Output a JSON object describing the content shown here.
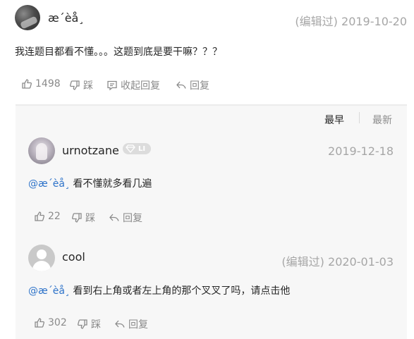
{
  "post": {
    "username": "æ´èå¸",
    "edited_label": "(编辑过)",
    "date": "2019-10-20",
    "content": "我连题目都看不懂。。。这题到底是要干嘛？？？",
    "likes": "1498",
    "dislike_label": "踩",
    "collapse_label": "收起回复",
    "reply_label": "回复"
  },
  "replies_panel": {
    "sort_earliest": "最早",
    "sort_latest": "最新",
    "replies": [
      {
        "username": "urnotzane",
        "badge": "LI",
        "date": "2019-12-18",
        "mention": "@æ´èå¸",
        "content": " 看不懂就多看几遍",
        "likes": "22",
        "dislike_label": "踩",
        "reply_label": "回复"
      },
      {
        "username": "cool",
        "edited_label": "(编辑过)",
        "date": "2020-01-03",
        "mention": "@æ´èå¸",
        "content": " 看到右上角或者左上角的那个叉叉了吗，请点击他",
        "likes": "302",
        "dislike_label": "踩",
        "reply_label": "回复"
      }
    ]
  },
  "colors": {
    "mention": "#2e73c9",
    "muted": "#8a8a8a",
    "panel_bg": "#f7f7f7"
  }
}
